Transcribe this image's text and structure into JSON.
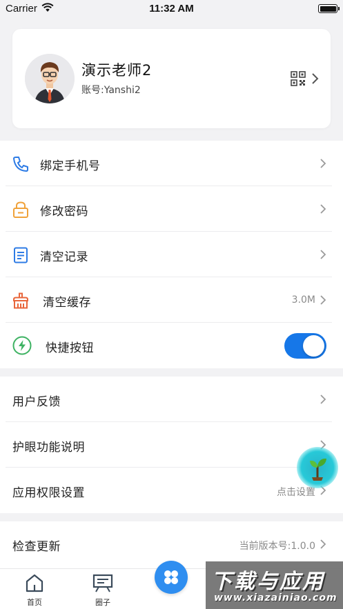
{
  "status_bar": {
    "carrier": "Carrier",
    "time": "11:32 AM",
    "battery_level": 1.0
  },
  "profile": {
    "name": "演示老师2",
    "account": "账号:Yanshi2",
    "avatar_icon": "teacher-avatar",
    "qr_icon": "qr-code-icon"
  },
  "settings": {
    "group1": [
      {
        "label": "绑定手机号",
        "icon": "phone-icon",
        "color": "#2d7be5"
      },
      {
        "label": "修改密码",
        "icon": "lock-icon",
        "color": "#f0a23a"
      },
      {
        "label": "清空记录",
        "icon": "document-icon",
        "color": "#2d7be5"
      },
      {
        "label": "清空缓存",
        "icon": "broom-icon",
        "color": "#e8663b",
        "value": "3.0M"
      },
      {
        "label": "快捷按钮",
        "icon": "lightning-icon",
        "color": "#3db262",
        "toggle_on": true
      }
    ],
    "group2": [
      {
        "label": "用户反馈"
      },
      {
        "label": "护眼功能说明"
      },
      {
        "label": "应用权限设置",
        "value": "点击设置"
      }
    ],
    "group3": [
      {
        "label": "检查更新",
        "value": "当前版本号:1.0.0"
      }
    ]
  },
  "tabbar": {
    "tabs": [
      {
        "label": "首页",
        "icon": "home-icon"
      },
      {
        "label": "圈子",
        "icon": "board-icon"
      }
    ],
    "center_icon": "apps-grid-icon",
    "accent": "#2f8ef0"
  },
  "watermark": {
    "main": "下载与应用",
    "sub": "www.xiazainiao.com"
  }
}
